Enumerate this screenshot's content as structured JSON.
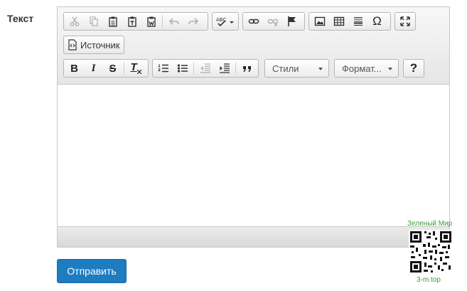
{
  "form": {
    "field_label": "Текст",
    "submit_label": "Отправить"
  },
  "toolbar": {
    "source_label": "Источник",
    "styles_combo": "Стили",
    "format_combo": "Формат...",
    "help_label": "?",
    "icons": [
      "cut-icon",
      "copy-icon",
      "paste-icon",
      "paste-text-icon",
      "paste-word-icon",
      "undo-icon",
      "redo-icon",
      "spellcheck-icon",
      "link-icon",
      "unlink-icon",
      "anchor-icon",
      "image-icon",
      "table-icon",
      "horizontal-line-icon",
      "special-char-icon",
      "maximize-icon",
      "source-icon",
      "bold-icon",
      "italic-icon",
      "strike-icon",
      "remove-format-icon",
      "numbered-list-icon",
      "bulleted-list-icon",
      "outdent-icon",
      "indent-icon",
      "blockquote-icon"
    ],
    "glyphs": {
      "bold": "B",
      "italic": "I",
      "strike": "S",
      "remove_format": "T",
      "special_char": "Ω",
      "spell": "ABC"
    }
  },
  "editor": {
    "content": ""
  },
  "watermark": {
    "title": "Зеленый Мир",
    "url": "3-m.top"
  },
  "colors": {
    "accent": "#1e7cc0",
    "watermark": "#3a9a3a"
  }
}
